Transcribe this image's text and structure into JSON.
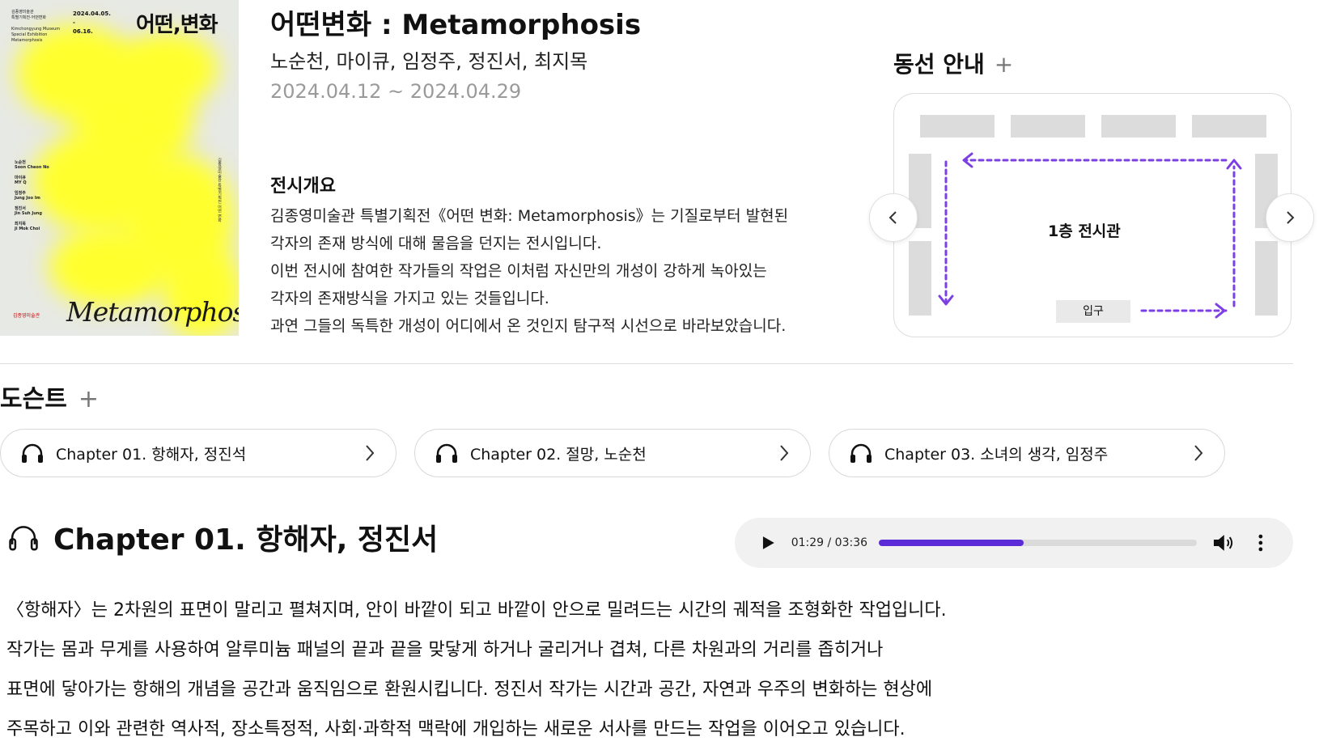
{
  "poster": {
    "title": "어떤,변화",
    "dates": [
      "2024.04.05.",
      "-",
      "06.16."
    ],
    "org_lines": [
      "김종영미술관",
      "특별기획전·어떤변화",
      "",
      "Kimchongyung Museum",
      "Special Exhibition",
      "Metamorphosis"
    ],
    "artists": [
      {
        "ko": "노순천",
        "en": "Soon Cheon No"
      },
      {
        "ko": "마이큐",
        "en": "MY Q"
      },
      {
        "ko": "임정주",
        "en": "Jung Joo Im"
      },
      {
        "ko": "정진서",
        "en": "Jin Suh Jung"
      },
      {
        "ko": "최지목",
        "en": "Ji Mok Choi"
      }
    ],
    "script_title": "Metamorphosis",
    "logo_text": "김종영미술관",
    "vertical_text": "김종영미술관 특별기획전 어떤 변화"
  },
  "header": {
    "title": "어떤변화 : Metamorphosis",
    "artists": "노순천, 마이큐, 임정주, 정진서, 최지목",
    "period": "2024.04.12 ~ 2024.04.29"
  },
  "overview": {
    "title": "전시개요",
    "lines": [
      "김종영미술관 특별기획전《어떤 변화: Metamorphosis》는 기질로부터 발현된",
      "각자의 존재 방식에 대해 물음을 던지는 전시입니다.",
      "이번 전시에 참여한 작가들의 작업은 이처럼 자신만의 개성이 강하게 녹아있는",
      "각자의 존재방식을 가지고 있는 것들입니다.",
      "과연 그들의 독특한 개성이 어디에서 온 것인지 탐구적 시선으로 바라보았습니다."
    ]
  },
  "route": {
    "title": "동선 안내",
    "plus": "+",
    "hall_label": "1층 전시관",
    "entry_label": "입구",
    "arrow_color": "#7b3fe4"
  },
  "docent": {
    "title": "도슨트",
    "plus": "+",
    "chapters": [
      {
        "label": "Chapter 01. 항해자, 정진석"
      },
      {
        "label": "Chapter 02. 절망, 노순천"
      },
      {
        "label": "Chapter 03. 소녀의 생각, 임정주"
      }
    ]
  },
  "now_playing": {
    "title": "Chapter 01. 항해자, 정진서",
    "time": "01:29 / 03:36",
    "progress": 0.455,
    "accent": "#5a2bd6",
    "description": [
      "〈항해자〉는 2차원의 표면이 말리고 펼쳐지며, 안이 바깥이 되고 바깥이 안으로 밀려드는 시간의 궤적을 조형화한 작업입니다.",
      "작가는 몸과 무게를 사용하여 알루미늄 패널의 끝과 끝을 맞닿게 하거나 굴리거나 겹쳐, 다른 차원과의 거리를 좁히거나",
      "표면에 닿아가는 항해의 개념을 공간과 움직임으로 환원시킵니다. 정진서 작가는 시간과 공간, 자연과 우주의 변화하는 현상에",
      "주목하고 이와 관련한 역사적, 장소특정적, 사회·과학적 맥락에 개입하는 새로운 서사를 만드는 작업을 이어오고 있습니다."
    ]
  }
}
